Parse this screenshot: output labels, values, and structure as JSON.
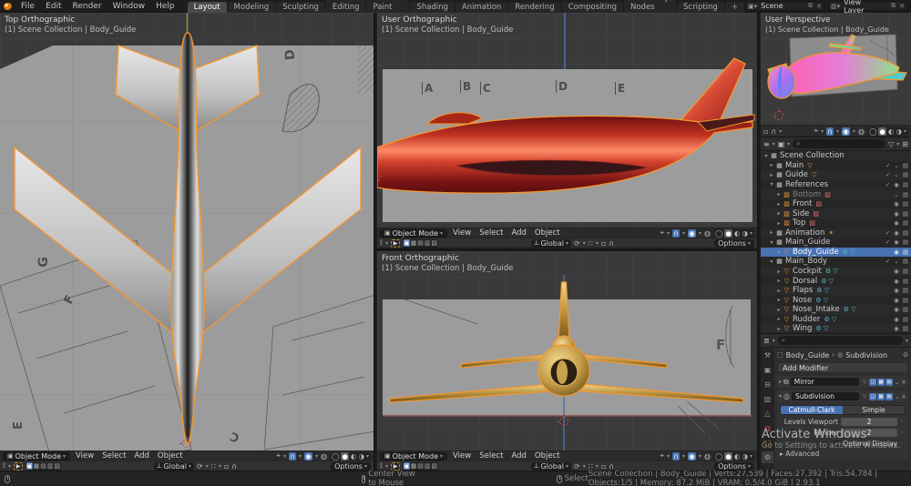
{
  "colors": {
    "accent_orange": "#f5962d",
    "accent_blue": "#4772b3",
    "viewport_bg": "#3a3a3a",
    "reference_grey": "#9c9c9c"
  },
  "topbar": {
    "menus": [
      {
        "label": "File"
      },
      {
        "label": "Edit"
      },
      {
        "label": "Render"
      },
      {
        "label": "Window"
      },
      {
        "label": "Help"
      }
    ],
    "tabs": [
      {
        "label": "Layout",
        "cls": "active"
      },
      {
        "label": "Modeling",
        "cls": ""
      },
      {
        "label": "Sculpting",
        "cls": ""
      },
      {
        "label": "UV Editing",
        "cls": ""
      },
      {
        "label": "Texture Paint",
        "cls": ""
      },
      {
        "label": "Shading",
        "cls": ""
      },
      {
        "label": "Animation",
        "cls": ""
      },
      {
        "label": "Rendering",
        "cls": ""
      },
      {
        "label": "Compositing",
        "cls": ""
      },
      {
        "label": "Geometry Nodes",
        "cls": ""
      },
      {
        "label": "Scripting",
        "cls": ""
      },
      {
        "label": "+",
        "cls": "plus"
      }
    ],
    "scene": "Scene",
    "view_layer": "View Layer"
  },
  "vph": {
    "mode": "Object Mode",
    "menus": [
      "View",
      "Select",
      "Add",
      "Object"
    ],
    "orientation": "Global",
    "options": "Options"
  },
  "viewports": {
    "top_left": {
      "title": "Top Orthographic",
      "context": "(1) Scene Collection | Body_Guide"
    },
    "mid_top": {
      "title": "User Orthographic",
      "context": "(1) Scene Collection | Body_Guide"
    },
    "mid_bottom": {
      "title": "Front Orthographic",
      "context": "(1) Scene Collection | Body_Guide"
    },
    "perspective": {
      "title": "User Perspective",
      "context": "(1) Scene Collection | Body_Guide"
    }
  },
  "letters": {
    "left": [
      {
        "t": "D",
        "cls": "lp-D"
      },
      {
        "t": "G",
        "cls": "lp-G"
      },
      {
        "t": "F",
        "cls": "lp-F2"
      },
      {
        "t": "E",
        "cls": "lp-E2"
      },
      {
        "t": "C",
        "cls": "lp-C2"
      }
    ],
    "mid": [
      {
        "t": "A",
        "cls": "lp-A tick"
      },
      {
        "t": "B",
        "cls": "lp-B tick"
      },
      {
        "t": "C",
        "cls": "lp-C tick"
      },
      {
        "t": "D",
        "cls": "lp-Dm tick"
      },
      {
        "t": "E",
        "cls": "lp-Em tick"
      }
    ],
    "front": [
      {
        "t": "F",
        "cls": "lp-F"
      }
    ]
  },
  "outliner": {
    "search_placeholder": "⌕",
    "rows": [
      {
        "ar": "▾",
        "icon": "▦",
        "icls": "col",
        "label": "Scene Collection",
        "extra": "",
        "ecls": "",
        "tog": "",
        "cls": ""
      },
      {
        "ar": "▸",
        "icon": "▦",
        "icls": "col",
        "label": "Main",
        "extra": "▽",
        "ecls": "org",
        "tog": "✓ ⌄ ▤",
        "cls": "lv1"
      },
      {
        "ar": "▸",
        "icon": "▦",
        "icls": "col",
        "label": "Guide",
        "extra": "▽",
        "ecls": "org",
        "tog": "✓ ⌄ ▤",
        "cls": "lv1"
      },
      {
        "ar": "▾",
        "icon": "▦",
        "icls": "col",
        "label": "References",
        "extra": "",
        "ecls": "",
        "tog": "✓ ◉ ▤",
        "cls": "lv1"
      },
      {
        "ar": "▸",
        "icon": "▨",
        "icls": "org",
        "label": "Bottom",
        "extra": "▨",
        "ecls": "pink",
        "tog": "⌄ ▤",
        "cls": "lv2 dim"
      },
      {
        "ar": "▸",
        "icon": "▨",
        "icls": "org",
        "label": "Front",
        "extra": "▨",
        "ecls": "pink",
        "tog": "◉ ▤",
        "cls": "lv2"
      },
      {
        "ar": "▸",
        "icon": "▨",
        "icls": "org",
        "label": "Side",
        "extra": "▨",
        "ecls": "pink",
        "tog": "◉ ▤",
        "cls": "lv2"
      },
      {
        "ar": "▸",
        "icon": "▨",
        "icls": "org",
        "label": "Top",
        "extra": "▨",
        "ecls": "pink",
        "tog": "◉ ▤",
        "cls": "lv2"
      },
      {
        "ar": "▸",
        "icon": "▦",
        "icls": "col",
        "label": "Animation",
        "extra": "✶",
        "ecls": "org",
        "tog": "✓ ◉ ▤",
        "cls": "lv1"
      },
      {
        "ar": "▾",
        "icon": "▦",
        "icls": "col",
        "label": "Main_Guide",
        "extra": "",
        "ecls": "",
        "tog": "✓ ◉ ▤",
        "cls": "lv1"
      },
      {
        "ar": "▸",
        "icon": "▽",
        "icls": "org",
        "label": "Body_Guide",
        "extra": "⚙ ▽",
        "ecls": "mods",
        "tog": "◉ ▤",
        "cls": "lv2 sel"
      },
      {
        "ar": "▾",
        "icon": "▦",
        "icls": "col",
        "label": "Main_Body",
        "extra": "",
        "ecls": "",
        "tog": "✓ ⌄ ▤",
        "cls": "lv1"
      },
      {
        "ar": "▸",
        "icon": "▽",
        "icls": "org",
        "label": "Cockpit",
        "extra": "⚙ ▽",
        "ecls": "mods",
        "tog": "◉ ▤",
        "cls": "lv2"
      },
      {
        "ar": "▸",
        "icon": "▽",
        "icls": "org",
        "label": "Dorsal",
        "extra": "⚙ ▽",
        "ecls": "mods",
        "tog": "◉ ▤",
        "cls": "lv2"
      },
      {
        "ar": "▸",
        "icon": "▽",
        "icls": "org",
        "label": "Flaps",
        "extra": "⚙ ▽",
        "ecls": "mods",
        "tog": "◉ ▤",
        "cls": "lv2"
      },
      {
        "ar": "▸",
        "icon": "▽",
        "icls": "org",
        "label": "Nose",
        "extra": "⚙ ▽",
        "ecls": "mods",
        "tog": "◉ ▤",
        "cls": "lv2"
      },
      {
        "ar": "▸",
        "icon": "▽",
        "icls": "org",
        "label": "Nose_Intake",
        "extra": "⚙ ▽",
        "ecls": "mods",
        "tog": "◉ ▤",
        "cls": "lv2"
      },
      {
        "ar": "▸",
        "icon": "▽",
        "icls": "org",
        "label": "Rudder",
        "extra": "⚙ ▽",
        "ecls": "mods",
        "tog": "◉ ▤",
        "cls": "lv2"
      },
      {
        "ar": "▸",
        "icon": "▽",
        "icls": "org",
        "label": "Wing",
        "extra": "⚙ ▽",
        "ecls": "mods",
        "tog": "◉ ▤",
        "cls": "lv2"
      }
    ]
  },
  "properties": {
    "tabs": [
      {
        "g": "⚒",
        "cls": ""
      },
      {
        "g": "▣",
        "cls": ""
      },
      {
        "g": "⊟",
        "cls": ""
      },
      {
        "g": "▥",
        "cls": ""
      },
      {
        "g": "△",
        "cls": ""
      },
      {
        "g": "◍",
        "cls": "red"
      },
      {
        "g": "⬚",
        "cls": "org"
      },
      {
        "g": "⚙",
        "cls": "active"
      }
    ],
    "breadcrumb": {
      "object": "Body_Guide",
      "modifier": "Subdivision"
    },
    "add_modifier": "Add Modifier",
    "mirror": {
      "name": "Mirror"
    },
    "subdivision": {
      "name": "Subdivision",
      "catmull": "Catmull-Clark",
      "simple": "Simple",
      "levels_viewport_label": "Levels Viewport",
      "levels_viewport": "2",
      "render_label": "Render",
      "render": "2",
      "optimal_display": "Optimal Display",
      "advanced": "Advanced"
    }
  },
  "watermark": {
    "line1": "Activate Windows",
    "line2": "Go to Settings to activate Windows."
  },
  "statusbar": {
    "hint1": "Center View to Mouse",
    "hint2": "Select",
    "stats": "Scene Collection | Body_Guide | Verts:27,539 | Faces:27,392 | Tris:54,784 | Objects:1/5 | Memory: 87.2 MiB | VRAM: 0.5/4.0 GiB | 2.93.1"
  }
}
